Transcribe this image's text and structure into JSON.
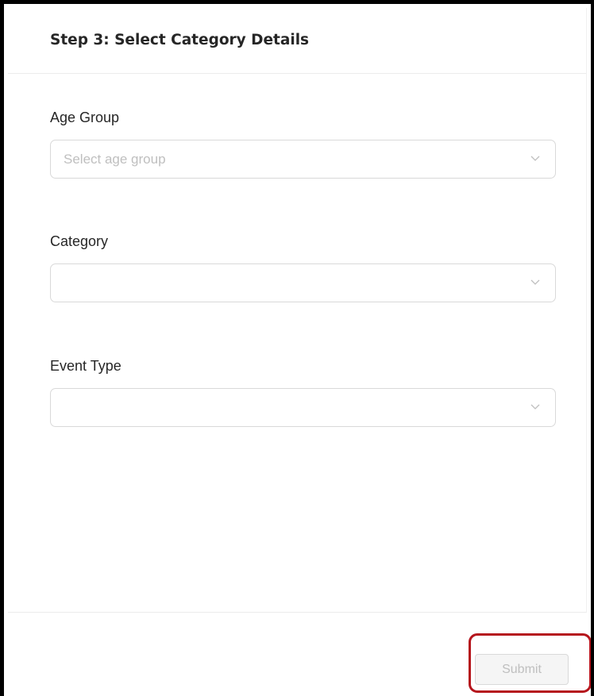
{
  "header": {
    "title": "Step 3: Select Category Details"
  },
  "fields": {
    "age_group": {
      "label": "Age Group",
      "placeholder": "Select age group",
      "value": ""
    },
    "category": {
      "label": "Category",
      "placeholder": "",
      "value": ""
    },
    "event_type": {
      "label": "Event Type",
      "placeholder": "",
      "value": ""
    }
  },
  "footer": {
    "submit_label": "Submit",
    "submit_disabled": true
  },
  "icons": {
    "select_arrow": "chevron-down-icon"
  },
  "colors": {
    "highlight_border": "#b5141c",
    "disabled_text": "#bfbfbf",
    "input_border": "#d9d9d9"
  }
}
